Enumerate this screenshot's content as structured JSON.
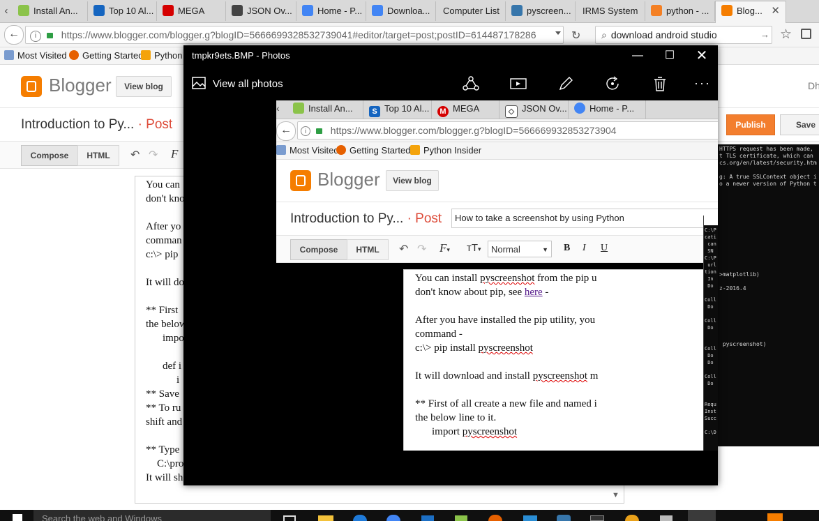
{
  "browser": {
    "tabs": [
      {
        "label": "Install An...",
        "icon": "android-icon",
        "color": "#8bc34a"
      },
      {
        "label": "Top 10 Al...",
        "icon": "s-icon",
        "color": "#1565c0"
      },
      {
        "label": "MEGA",
        "icon": "mega-icon",
        "color": "#d50000"
      },
      {
        "label": "JSON Ov...",
        "icon": "json-icon",
        "color": "#444444"
      },
      {
        "label": "Home - P...",
        "icon": "chrome-icon",
        "color": "#4285f4"
      },
      {
        "label": "Downloa...",
        "icon": "chrome-icon",
        "color": "#4285f4"
      },
      {
        "label": "Computer List",
        "icon": "",
        "color": ""
      },
      {
        "label": "pyscreen...",
        "icon": "python-icon",
        "color": "#3776ab"
      },
      {
        "label": "IRMS System",
        "icon": "",
        "color": ""
      },
      {
        "label": "python - ...",
        "icon": "stackoverflow-icon",
        "color": "#f48024"
      },
      {
        "label": "Blog...",
        "icon": "blogger-icon",
        "color": "#f57d00"
      }
    ],
    "url": "https://www.blogger.com/blogger.g?blogID=5666699328532739041#editor/target=post;postID=614487178286",
    "search_value": "download android studio",
    "bookmarks": [
      "Most Visited",
      "Getting Started",
      "Python"
    ]
  },
  "blogger": {
    "brand": "Blogger",
    "view_blog": "View blog",
    "post_title": "Introduction to Py...",
    "post_suffix": "· Post",
    "compose": "Compose",
    "html": "HTML",
    "publish": "Publish",
    "save": "Save",
    "editor_fragments": [
      "You can",
      "don't kno",
      "",
      "After yo",
      "comman",
      "c:\\> pip",
      "",
      "It will do",
      "",
      "** First",
      "the below",
      "impo",
      "",
      "def i",
      "i",
      "** Save",
      "** To ru",
      "shift and",
      "",
      "** Type",
      "C:\\pro",
      "It will sh"
    ]
  },
  "photos": {
    "title": "tmpkr9ets.BMP - Photos",
    "view_all": "View all photos"
  },
  "screenshot": {
    "tabs": [
      "Install An...",
      "Top 10 Al...",
      "MEGA",
      "JSON Ov...",
      "Home - P..."
    ],
    "url": "https://www.blogger.com/blogger.g?blogID=566669932853273904",
    "bookmarks": [
      "Most Visited",
      "Getting Started",
      "Python Insider"
    ],
    "brand": "Blogger",
    "view_blog": "View blog",
    "post_title": "Introduction to Py...",
    "post_suffix": "· Post",
    "title_input": "How to take a screenshot by using Python",
    "compose": "Compose",
    "html": "HTML",
    "font_size": "Normal",
    "body": {
      "l1a": "You can install ",
      "l1b": "pyscreenshot",
      "l1c": "  from the pip u",
      "l2a": "don't know about pip, see ",
      "l2link": "here",
      "l2b": "  -",
      "l3": "After you have installed the pip utility, you",
      "l4": "command -",
      "l5a": "c:\\> pip install ",
      "l5b": "pyscreenshot",
      "l6a": "It will download and install ",
      "l6b": "pyscreenshot",
      "l6c": " m",
      "l7": "** First of all create a new file and named i",
      "l8": "the below line to it.",
      "l9a": "import ",
      "l9b": "pyscreenshot"
    }
  },
  "console": {
    "right_lines": [
      "HTTPS request has been made,",
      "t TLS certificate, which can",
      "cs.org/en/latest/security.htm",
      "",
      "g: A true SSLContext object i",
      "o a newer version of Python t",
      "",
      "",
      "",
      "",
      "",
      "",
      "",
      "",
      "",
      "",
      "",
      "",
      ">matplotlib)",
      "",
      "z-2016.4",
      "",
      "",
      "",
      "",
      "",
      "",
      "",
      " pyscreenshot)"
    ],
    "inner_lines": [
      "C:\\P",
      "cati",
      " can",
      " SN",
      "C:\\P",
      " url",
      "tion",
      " In",
      " Do",
      "",
      "Coll",
      " Do",
      "",
      "Coll",
      " Do",
      "",
      "",
      "Coll",
      " Do",
      " Do",
      "",
      "Coll",
      " Do",
      "",
      "",
      "Requ",
      "Inst",
      "Succ",
      "",
      "C:\\D"
    ]
  },
  "taskbar": {
    "search": "Search the web and Windows"
  }
}
